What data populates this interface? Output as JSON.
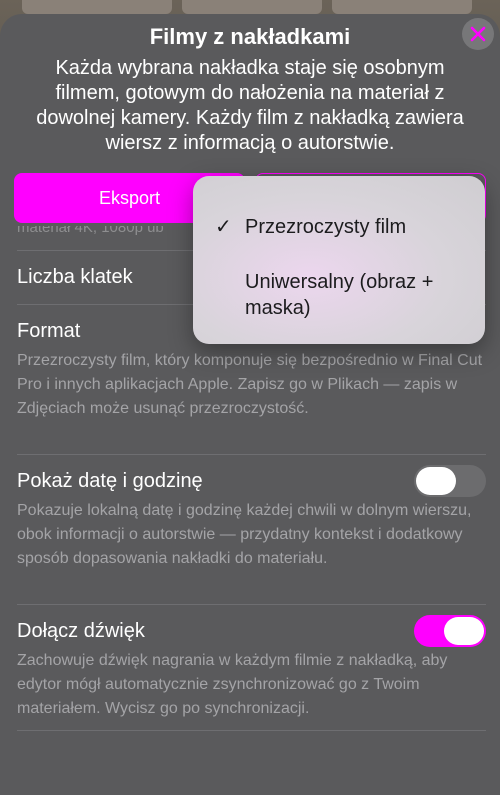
{
  "sheet": {
    "title": "Filmy z nakładkami",
    "subtitle": "Każda wybrana nakładka staje się osobnym filmem, gotowym do nałożenia na materiał z dowolnej kamery. Każdy film z nakładką zawiera wiersz z informacją o autorstwie.",
    "close_icon": "close-icon",
    "accent_color": "#ff00ff"
  },
  "buttons": {
    "export_label": "Eksport"
  },
  "resolution_row": {
    "partial_detail": "materiał 4K, 1080p ub"
  },
  "frame_rate_row": {
    "label": "Liczba klatek"
  },
  "format_row": {
    "label": "Format",
    "description": "Przezroczysty film, który komponuje się bezpośrednio w Final Cut Pro i innych aplikacjach Apple. Zapisz go w Plikach — zapis w Zdjęciach może usunąć przezroczystość."
  },
  "date_row": {
    "label": "Pokaż datę i godzinę",
    "description": "Pokazuje lokalną datę i godzinę każdej chwili w dolnym wierszu, obok informacji o autorstwie — przydatny kontekst i dodatkowy sposób dopasowania nakładki do materiału.",
    "enabled": false
  },
  "audio_row": {
    "label": "Dołącz dźwięk",
    "description": "Zachowuje dźwięk nagrania w każdym filmie z nakładką, aby edytor mógł automatycznie zsynchronizować go z Twoim materiałem. Wycisz go po synchronizacji.",
    "enabled": true
  },
  "format_menu": {
    "options": [
      {
        "label": "Przezroczysty film",
        "selected": true
      },
      {
        "label": "Uniwersalny (obraz + maska)",
        "selected": false
      }
    ],
    "check_glyph": "✓"
  }
}
